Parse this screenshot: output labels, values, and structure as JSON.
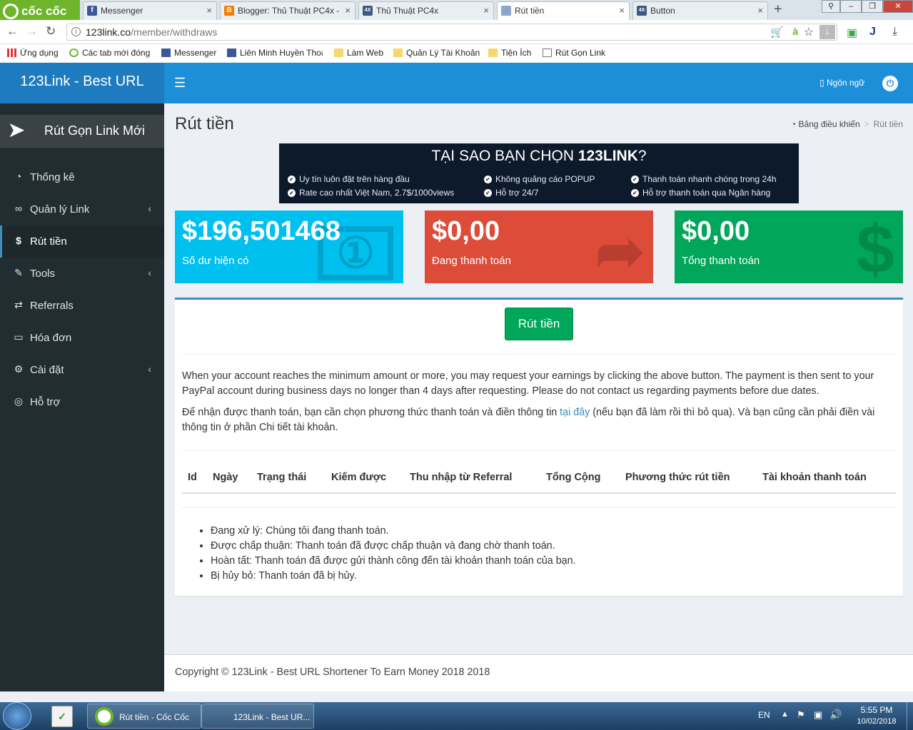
{
  "browser": {
    "brand": "cốc cốc",
    "tabs": [
      {
        "title": "Messenger",
        "icon": "facebook-icon",
        "color": "#3b5998",
        "glyph": "f"
      },
      {
        "title": "Blogger: Thủ Thuật PC4x -",
        "icon": "blogger-icon",
        "color": "#f57d00",
        "glyph": "B"
      },
      {
        "title": "Thủ Thuật PC4x",
        "icon": "pc4x-icon",
        "color": "#3d5a80",
        "glyph": "4X"
      },
      {
        "title": "Rút tiền",
        "icon": "page-icon",
        "color": "#8aa9c9",
        "glyph": ""
      },
      {
        "title": "Button",
        "icon": "pc4x-icon",
        "color": "#3d5a80",
        "glyph": "4X"
      }
    ],
    "url_host": "123link.co",
    "url_path": "/member/withdraws",
    "bookmarks": [
      {
        "label": "Ứng dụng",
        "icon": "apps-icon"
      },
      {
        "label": "Các tab mới đóng",
        "icon": "history-icon"
      },
      {
        "label": "Messenger",
        "icon": "facebook-icon"
      },
      {
        "label": "Liên Minh Huyền Thoại",
        "icon": "facebook-icon"
      },
      {
        "label": "Làm Web",
        "icon": "folder-icon"
      },
      {
        "label": "Quản Lý Tài Khoản",
        "icon": "folder-icon"
      },
      {
        "label": "Tiện Ích",
        "icon": "folder-icon"
      },
      {
        "label": "Rút Gọn Link",
        "icon": "page-icon"
      }
    ]
  },
  "site": {
    "logo": "123Link - Best URL",
    "language": "Ngôn ngữ",
    "new_link": "Rút Gọn Link Mới",
    "menu": [
      {
        "label": "Thống kê",
        "icon": "dashboard-icon",
        "glyph": "◔",
        "arrow": false
      },
      {
        "label": "Quản lý Link",
        "icon": "link-icon",
        "glyph": "🔗",
        "arrow": true
      },
      {
        "label": "Rút tiền",
        "icon": "dollar-icon",
        "glyph": "$",
        "arrow": false,
        "active": true
      },
      {
        "label": "Tools",
        "icon": "wrench-icon",
        "glyph": "🔧",
        "arrow": true
      },
      {
        "label": "Referrals",
        "icon": "exchange-icon",
        "glyph": "⇄",
        "arrow": false
      },
      {
        "label": "Hóa đơn",
        "icon": "credit-card-icon",
        "glyph": "▭",
        "arrow": false
      },
      {
        "label": "Cài đặt",
        "icon": "cogs-icon",
        "glyph": "⚙",
        "arrow": true
      },
      {
        "label": "Hỗ trợ",
        "icon": "life-ring-icon",
        "glyph": "◎",
        "arrow": false
      }
    ]
  },
  "page": {
    "title": "Rút tiền",
    "breadcrumb": [
      "Bảng điều khiển",
      "Rút tiền"
    ],
    "banner": {
      "title_pre": "TẠI SAO BẠN CHỌN ",
      "title_brand": "123LINK",
      "title_post": "?",
      "points": [
        "Uy tín luôn đặt trên hàng đầu",
        "Rate cao nhất Việt Nam, 2.7$/1000views",
        "Không quảng cáo POPUP",
        "Hỗ trợ 24/7",
        "Thanh toán nhanh chóng trong 24h",
        "Hỗ trợ thanh toán qua Ngân hàng"
      ]
    },
    "stats": [
      {
        "value": "$196,501468",
        "label": "Số dư hiện có",
        "icon": "money-icon",
        "color": "#00c0ef"
      },
      {
        "value": "$0,00",
        "label": "Đang thanh toán",
        "icon": "share-arrow-icon",
        "color": "#dd4b39"
      },
      {
        "value": "$0,00",
        "label": "Tổng thanh toán",
        "icon": "dollar-icon",
        "color": "#00a65a"
      }
    ],
    "withdraw_button": "Rút tiền",
    "info_en": "When your account reaches the minimum amount or more, you may request your earnings by clicking the above button. The payment is then sent to your PayPal account during business days no longer than 4 days after requesting. Please do not contact us regarding payments before due dates.",
    "info_vi_before": "Để nhận được thanh toán, bạn cần chọn phương thức thanh toán và điền thông tin ",
    "info_vi_link": "tại đây",
    "info_vi_after": " (nếu bạn đã làm rồi thì bỏ qua). Và bạn cũng cần phải điền vài thông tin ở phần Chi tiết tài khoản.",
    "table_headers": [
      "Id",
      "Ngày",
      "Trạng thái",
      "Kiếm được",
      "Thu nhập từ Referral",
      "Tổng Cộng",
      "Phương thức rút tiền",
      "Tài khoản thanh toán"
    ],
    "legend": [
      "Đang xử lý: Chúng tôi đang thanh toán.",
      "Được chấp thuận: Thanh toán đã được chấp thuận và đang chờ thanh toán.",
      "Hoàn tất: Thanh toán đã được gửi thành công đến tài khoản thanh toán của bạn.",
      "Bị hủy bỏ: Thanh toán đã bị hủy."
    ],
    "footer": "Copyright © 123Link - Best URL Shortener To Earn Money 2018 2018"
  },
  "taskbar": {
    "apps": [
      "Rút tiền - Cốc Cốc",
      "123Link - Best UR..."
    ],
    "lang": "EN",
    "time": "5:55 PM",
    "date": "10/02/2018"
  }
}
